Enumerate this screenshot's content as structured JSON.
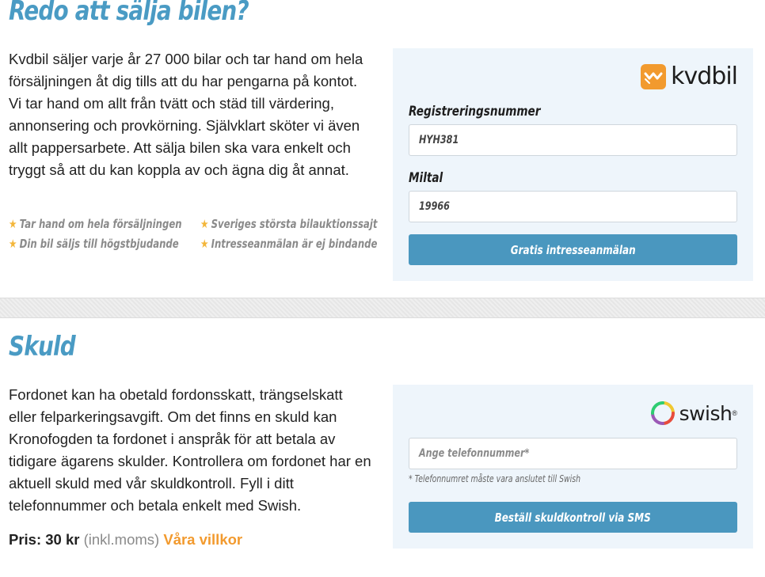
{
  "sell": {
    "heading": "Redo att sälja bilen?",
    "paragraph": "Kvdbil säljer varje år 27 000 bilar och tar hand om hela försäljningen åt dig tills att du har pengarna på kontot. Vi tar hand om allt från tvätt och städ till värdering, annonsering och provkörning. Självklart sköter vi även allt pappersarbete. Att sälja bilen ska vara enkelt och tryggt så att du kan koppla av och ägna dig åt annat.",
    "features": [
      "Tar hand om hela försäljningen",
      "Sveriges största bilauktionssajt",
      "Din bil säljs till högstbjudande",
      "Intresseanmälan är ej bindande"
    ],
    "panel": {
      "logo_text": "kvdbil",
      "logo_icon": "kvdbil-logo-icon",
      "reg_label": "Registreringsnummer",
      "reg_value": "HYH381",
      "miltal_label": "Miltal",
      "miltal_value": "19966",
      "button_label": "Gratis intresseanmälan"
    }
  },
  "debt": {
    "heading": "Skuld",
    "paragraph": "Fordonet kan ha obetald fordonsskatt, trängselskatt eller felparkeringsavgift. Om det finns en skuld kan Kronofogden ta fordonet i anspråk för att betala av tidigare ägarens skulder. Kontrollera om fordonet har en aktuell skuld med vår skuldkontroll. Fyll i ditt telefonnummer och betala enkelt med Swish.",
    "price_label": "Pris: 30 kr",
    "price_note": "(inkl.moms)",
    "terms_link": "Våra villkor",
    "panel": {
      "logo_text": "swish",
      "logo_mark": "®",
      "logo_icon": "swish-logo-icon",
      "phone_placeholder": "Ange telefonnummer*",
      "hint": "* Telefonnumret måste vara anslutet till Swish",
      "button_label": "Beställ skuldkontroll via SMS"
    }
  },
  "colors": {
    "heading_blue": "#4a9bc4",
    "button_blue": "#4a97bf",
    "panel_bg": "#eef5fb",
    "accent_orange": "#f29a2e",
    "star_yellow": "#f3b63a"
  }
}
